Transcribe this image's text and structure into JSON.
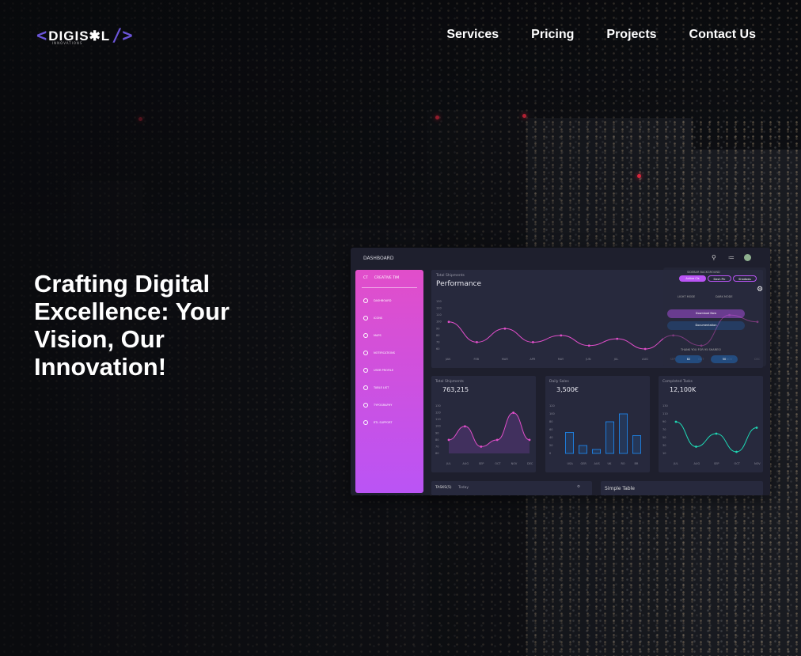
{
  "brand": {
    "name": "DIGIS✱L",
    "left_bracket": "<",
    "right_bracket": "/>",
    "tagline": "INNOVATIONS",
    "accent": "#6b55d9"
  },
  "nav": {
    "items": [
      "Services",
      "Pricing",
      "Projects",
      "Contact Us"
    ]
  },
  "hero": {
    "headline": "Crafting Digital Excellence: Your Vision, Our Innovation!"
  },
  "dashboard": {
    "topbar_title": "DASHBOARD",
    "sidebar": {
      "brand_short": "CT",
      "brand_name": "CREATIVE TIM",
      "items": [
        "DASHBOARD",
        "ICONS",
        "MAPS",
        "NOTIFICATIONS",
        "USER PROFILE",
        "TABLE LIST",
        "TYPOGRAPHY",
        "RTL SUPPORT"
      ]
    },
    "performance": {
      "label": "Total Shipments",
      "title": "Performance",
      "yticks": [
        "130",
        "120",
        "110",
        "100",
        "90",
        "80",
        "70",
        "60"
      ],
      "months": [
        "JAN",
        "FEB",
        "MAR",
        "APR",
        "MAY",
        "JUN",
        "JUL",
        "AUG",
        "SEP",
        "OCT",
        "NOV",
        "DEC"
      ],
      "values": [
        100,
        70,
        90,
        70,
        80,
        65,
        75,
        60,
        80,
        65,
        110,
        100
      ]
    },
    "cards": [
      {
        "label": "Total Shipments",
        "value": "763,215",
        "months": [
          "JUL",
          "AUG",
          "SEP",
          "OCT",
          "NOV",
          "DEC"
        ],
        "values": [
          80,
          100,
          70,
          80,
          120,
          80
        ],
        "yticks": [
          "130",
          "120",
          "110",
          "100",
          "90",
          "80",
          "70",
          "60"
        ]
      },
      {
        "label": "Daily Sales",
        "value": "3,500€",
        "months": [
          "USA",
          "GER",
          "AUS",
          "UK",
          "RO",
          "BR"
        ],
        "values": [
          53,
          20,
          10,
          80,
          100,
          45
        ],
        "yticks": [
          "120",
          "100",
          "80",
          "60",
          "40",
          "20",
          "0"
        ]
      },
      {
        "label": "Completed Tasks",
        "value": "12,100K",
        "months": [
          "JUL",
          "AUG",
          "SEP",
          "OCT",
          "NOV"
        ],
        "values": [
          90,
          27,
          60,
          14,
          75
        ],
        "yticks": [
          "130",
          "110",
          "90",
          "70",
          "50",
          "30",
          "10"
        ]
      }
    ],
    "bottom": {
      "left_title": "TASKS(5)",
      "left_sub": "Today",
      "right_title": "Simple Table"
    },
    "settings": {
      "header": "SIDEBAR BACKGROUND",
      "tabs": [
        "Active Cls",
        "Dash Pic",
        "Shadows"
      ],
      "mode_left": "LIGHT MODE",
      "mode_right": "DARK MODE",
      "buttons": [
        "Download Now",
        "Documentation"
      ],
      "thanks": "THANK YOU FOR 95 SHARES!",
      "share": [
        "82",
        "50"
      ]
    },
    "colors": {
      "pink": "#e14eca",
      "cyan": "#1ed9b5",
      "blue": "#1d8cf8"
    }
  }
}
